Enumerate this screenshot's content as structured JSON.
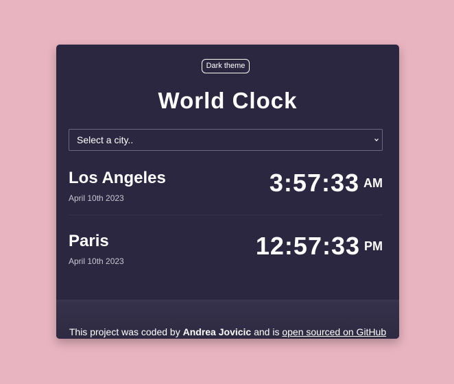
{
  "header": {
    "theme_button_label": "Dark theme",
    "title": "World Clock"
  },
  "city_select": {
    "selected": "Select a city..",
    "icon": "chevron-down-icon"
  },
  "cities": [
    {
      "name": "Los Angeles",
      "date": "April 10th 2023",
      "time": "3:57:33",
      "ampm": "AM"
    },
    {
      "name": "Paris",
      "date": "April 10th 2023",
      "time": "12:57:33",
      "ampm": "PM"
    }
  ],
  "footer": {
    "prefix": "This project was coded by",
    "author": "Andrea Jovicic",
    "middle": "and is",
    "link_text": "open sourced on GitHub"
  },
  "colors": {
    "page_background": "#e8b4c0",
    "card_background": "#2b2740",
    "text": "#ffffff"
  }
}
